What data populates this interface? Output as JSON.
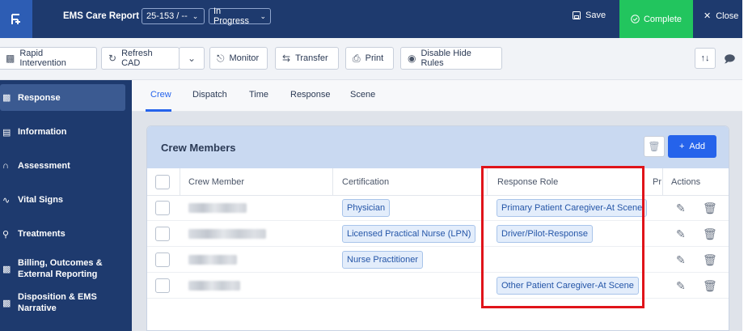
{
  "header": {
    "logo_glyph": "ᴓ",
    "title": "EMS Care Report",
    "incident_select": "25-153 / --",
    "status_select": "In Progress",
    "save_label": "Save",
    "complete_label": "Complete",
    "close_label": "Close"
  },
  "toolbar": {
    "buttons": [
      {
        "label": "Rapid Intervention",
        "icon": "ambulance-icon"
      },
      {
        "label": "Refresh CAD",
        "icon": "refresh-icon"
      },
      {
        "label": "Monitor",
        "icon": "monitor-icon"
      },
      {
        "label": "Transfer",
        "icon": "transfer-icon"
      },
      {
        "label": "Print",
        "icon": "print-icon"
      },
      {
        "label": "Disable Hide Rules",
        "icon": "eye-icon"
      }
    ],
    "sort_glyph": "↑↓"
  },
  "sidebar": {
    "items": [
      {
        "label": "Response",
        "icon": "ambulance-icon",
        "active": true
      },
      {
        "label": "Information",
        "icon": "id-card-icon"
      },
      {
        "label": "Assessment",
        "icon": "stethoscope-icon"
      },
      {
        "label": "Vital Signs",
        "icon": "heartbeat-icon"
      },
      {
        "label": "Treatments",
        "icon": "treatment-icon"
      },
      {
        "label": "Billing, Outcomes & External Reporting",
        "icon": "billing-icon"
      },
      {
        "label": "Disposition & EMS Narrative",
        "icon": "disposition-icon"
      }
    ]
  },
  "tabs": [
    {
      "label": "Crew",
      "active": true
    },
    {
      "label": "Dispatch"
    },
    {
      "label": "Time"
    },
    {
      "label": "Response"
    },
    {
      "label": "Scene"
    }
  ],
  "crew": {
    "title": "Crew Members",
    "add_label": "Add",
    "columns": {
      "member": "Crew Member",
      "certification": "Certification",
      "role": "Response Role",
      "pr": "Pr",
      "actions": "Actions"
    },
    "rows": [
      {
        "certification": "Physician",
        "role": "Primary Patient Caregiver-At Scene"
      },
      {
        "certification": "Licensed Practical Nurse (LPN)",
        "role": "Driver/Pilot-Response"
      },
      {
        "certification": "Nurse Practitioner",
        "role": ""
      },
      {
        "certification": "",
        "role": "Other Patient Caregiver-At Scene"
      }
    ]
  },
  "colors": {
    "header_bg": "#1e3a6e",
    "complete_bg": "#22c55e",
    "accent": "#2563eb",
    "highlight": "#e0141a"
  }
}
